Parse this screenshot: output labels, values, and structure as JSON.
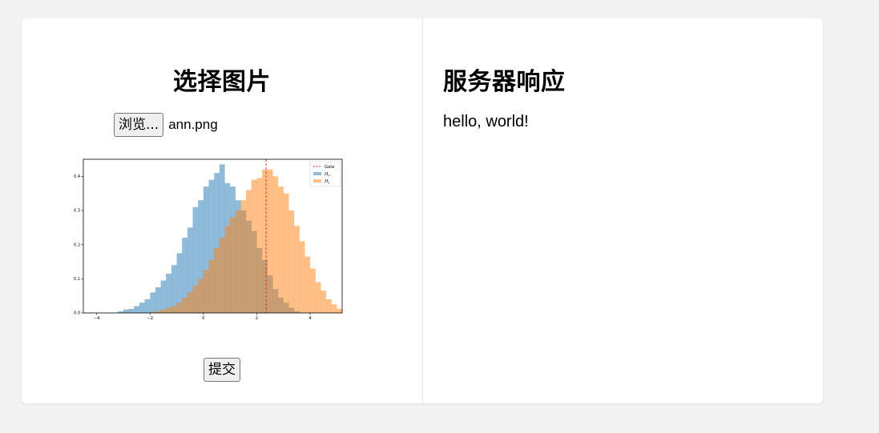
{
  "left": {
    "title": "选择图片",
    "browse_label": "浏览...",
    "file_name": "ann.png",
    "submit_label": "提交"
  },
  "right": {
    "title": "服务器响应",
    "response": "hello, world!"
  },
  "chart_data": {
    "type": "histogram",
    "xlim": [
      -4.5,
      5.2
    ],
    "ylim": [
      0,
      0.45
    ],
    "x_ticks": [
      -4,
      -2,
      0,
      2,
      4
    ],
    "y_ticks": [
      0.0,
      0.1,
      0.2,
      0.3,
      0.4
    ],
    "x_tick_labels": [
      "−4",
      "−2",
      "0",
      "2",
      "4"
    ],
    "y_tick_labels": [
      "0.0",
      "0.1",
      "0.2",
      "0.3",
      "0.4"
    ],
    "bin_width": 0.2,
    "gate": 2.35,
    "legend_position": "top-right",
    "legend": [
      "Gate",
      "H",
      "H"
    ],
    "legend_subscripts": [
      "",
      "0",
      "1"
    ],
    "series": [
      {
        "name": "H0",
        "color": "#1f77b4",
        "alpha": 0.5,
        "bins": [
          [
            -3.1,
            0.005
          ],
          [
            -2.9,
            0.01
          ],
          [
            -2.7,
            0.012
          ],
          [
            -2.5,
            0.02
          ],
          [
            -2.3,
            0.03
          ],
          [
            -2.1,
            0.04
          ],
          [
            -1.9,
            0.06
          ],
          [
            -1.7,
            0.075
          ],
          [
            -1.5,
            0.095
          ],
          [
            -1.3,
            0.115
          ],
          [
            -1.1,
            0.14
          ],
          [
            -0.9,
            0.175
          ],
          [
            -0.7,
            0.22
          ],
          [
            -0.5,
            0.25
          ],
          [
            -0.3,
            0.31
          ],
          [
            -0.1,
            0.33
          ],
          [
            0.1,
            0.37
          ],
          [
            0.3,
            0.39
          ],
          [
            0.5,
            0.41
          ],
          [
            0.7,
            0.435
          ],
          [
            0.9,
            0.38
          ],
          [
            1.1,
            0.37
          ],
          [
            1.3,
            0.33
          ],
          [
            1.5,
            0.3
          ],
          [
            1.7,
            0.27
          ],
          [
            1.9,
            0.24
          ],
          [
            2.1,
            0.19
          ],
          [
            2.3,
            0.155
          ],
          [
            2.5,
            0.11
          ],
          [
            2.7,
            0.07
          ],
          [
            2.9,
            0.045
          ],
          [
            3.1,
            0.03
          ],
          [
            3.3,
            0.015
          ],
          [
            3.5,
            0.005
          ]
        ]
      },
      {
        "name": "H1",
        "color": "#ff7f0e",
        "alpha": 0.5,
        "bins": [
          [
            -1.9,
            0.003
          ],
          [
            -1.7,
            0.005
          ],
          [
            -1.5,
            0.01
          ],
          [
            -1.3,
            0.015
          ],
          [
            -1.1,
            0.02
          ],
          [
            -0.9,
            0.03
          ],
          [
            -0.7,
            0.045
          ],
          [
            -0.5,
            0.06
          ],
          [
            -0.3,
            0.08
          ],
          [
            -0.1,
            0.1
          ],
          [
            0.1,
            0.125
          ],
          [
            0.3,
            0.155
          ],
          [
            0.5,
            0.19
          ],
          [
            0.7,
            0.22
          ],
          [
            0.9,
            0.255
          ],
          [
            1.1,
            0.28
          ],
          [
            1.3,
            0.3
          ],
          [
            1.5,
            0.33
          ],
          [
            1.7,
            0.36
          ],
          [
            1.9,
            0.39
          ],
          [
            2.1,
            0.395
          ],
          [
            2.3,
            0.42
          ],
          [
            2.5,
            0.42
          ],
          [
            2.7,
            0.4
          ],
          [
            2.9,
            0.37
          ],
          [
            3.1,
            0.35
          ],
          [
            3.3,
            0.3
          ],
          [
            3.5,
            0.255
          ],
          [
            3.7,
            0.21
          ],
          [
            3.9,
            0.165
          ],
          [
            4.1,
            0.13
          ],
          [
            4.3,
            0.09
          ],
          [
            4.5,
            0.065
          ],
          [
            4.7,
            0.04
          ],
          [
            4.9,
            0.025
          ],
          [
            5.1,
            0.012
          ]
        ]
      }
    ]
  }
}
